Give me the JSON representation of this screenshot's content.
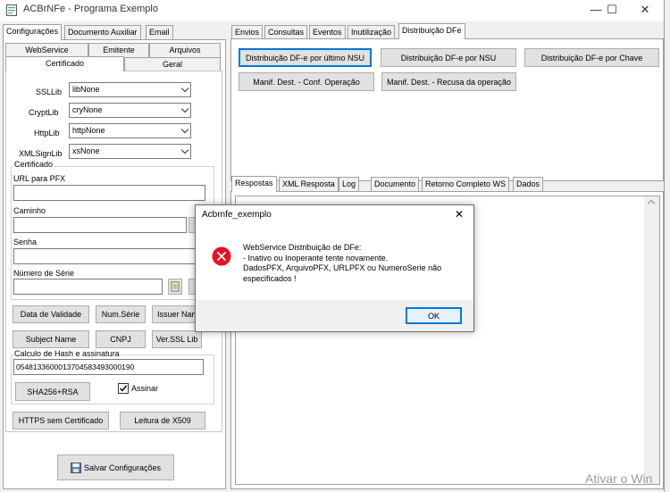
{
  "window": {
    "title": "ACBrNFe - Programa Exemplo",
    "minimize": "—",
    "maximize": "☐",
    "close": "✕"
  },
  "left": {
    "top_tabs": [
      "Configurações",
      "Documento Auxiliar",
      "Email"
    ],
    "sub_tabs_row1": [
      "WebService",
      "Emitente",
      "Arquivos"
    ],
    "sub_tabs_row2": [
      "Certificado",
      "Geral"
    ],
    "ssl": {
      "ssllib_label": "SSLLib",
      "ssllib_value": "libNone",
      "cryptlib_label": "CryptLib",
      "cryptlib_value": "cryNone",
      "httplib_label": "HttpLib",
      "httplib_value": "httpNone",
      "xmlsign_label": "XMLSignLib",
      "xmlsign_value": "xsNone"
    },
    "certificado": {
      "title": "Certificado",
      "url_label": "URL para PFX",
      "caminho_label": "Caminho",
      "senha_label": "Senha",
      "serie_label": "Número de Série"
    },
    "buttons": {
      "validade": "Data de Validade",
      "num_serie": "Num.Série",
      "issuer": "Issuer Name",
      "subject": "Subject Name",
      "cnpj": "CNPJ",
      "ver_ssl": "Ver.SSL Lib"
    },
    "hash": {
      "title": "Calculo de Hash e assinatura",
      "value": "0548133600013704583493000190",
      "sha_button": "SHA256+RSA",
      "assinar_label": "Assinar",
      "assinar_checked": true
    },
    "https_button": "HTTPS sem Certificado",
    "x509_button": "Leitura de X509",
    "save_button": "Salvar Configurações"
  },
  "right": {
    "top_tabs": [
      "Envios",
      "Consultas",
      "Eventos",
      "Inutilização",
      "Distribuição DFe"
    ],
    "actions": {
      "ultimo_nsu": "Distribuição DF-e por último NSU",
      "por_nsu": "Distribuição DF-e por NSU",
      "por_chave": "Distribuição DF-e por Chave",
      "conf_op": "Manif. Dest. - Conf. Operação",
      "recusa_op": "Manif. Dest. - Recusa da operação"
    },
    "bottom_tabs": [
      "Respostas",
      "XML Resposta",
      "Log",
      "Documento",
      "Retorno Completo WS",
      "Dados"
    ]
  },
  "dialog": {
    "title": "Acbrnfe_exemplo",
    "close": "✕",
    "line1": "WebService Distribuição de DFe:",
    "line2": "- Inativo ou Inoperante tente novamente.",
    "line3": "DadosPFX, ArquivoPFX, URLPFX ou NumeroSerie não",
    "line4": "especificados !",
    "ok": "OK"
  },
  "watermark": "Ativar o Win",
  "colors": {
    "accent": "#0078d7",
    "error": "#e81123",
    "window_bg": "#f0f0f0"
  }
}
